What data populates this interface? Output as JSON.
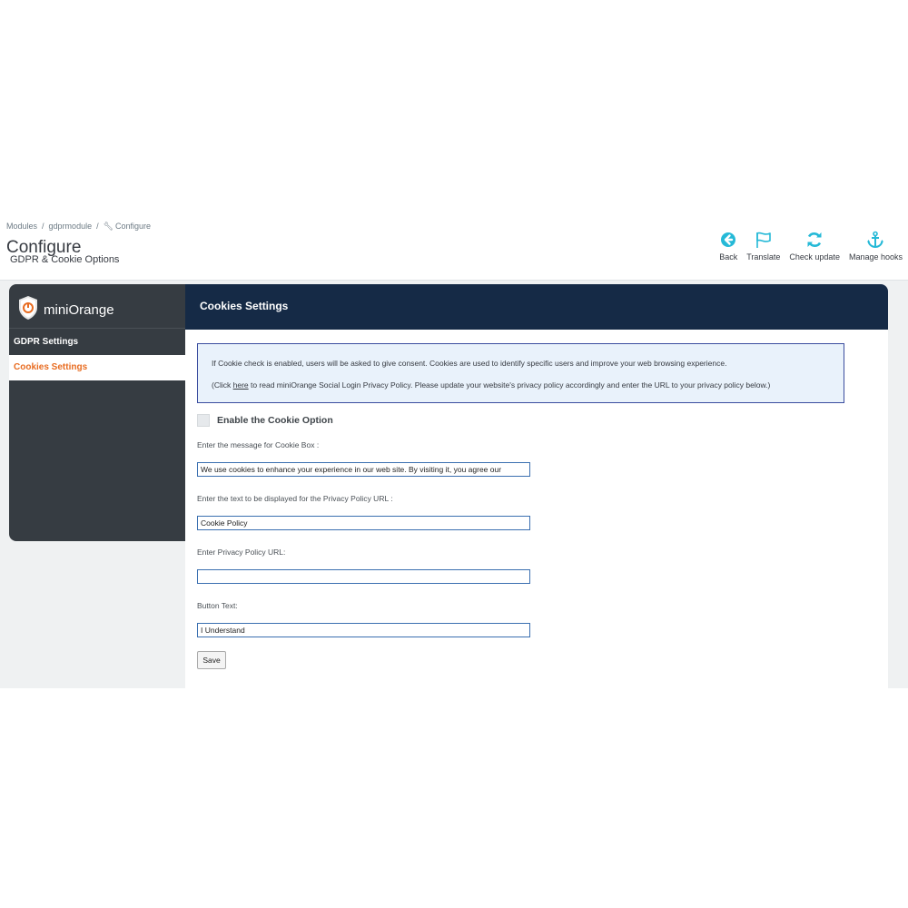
{
  "breadcrumb": {
    "items": [
      "Modules",
      "gdprmodule",
      "Configure"
    ]
  },
  "page": {
    "title": "Configure",
    "subtitle": "GDPR & Cookie Options"
  },
  "toolbar": {
    "back": "Back",
    "translate": "Translate",
    "check_update": "Check update",
    "manage_hooks": "Manage hooks"
  },
  "sidebar": {
    "brand": "miniOrange",
    "items": [
      {
        "label": "GDPR Settings",
        "active": false
      },
      {
        "label": "Cookies Settings",
        "active": true
      }
    ]
  },
  "main": {
    "title": "Cookies Settings",
    "info": {
      "line1": "If Cookie check is enabled, users will be asked to give consent. Cookies are used to identify specific users and improve your web browsing experience.",
      "line2_prefix": "(Click ",
      "link_text": "here",
      "line2_suffix": " to read miniOrange Social Login Privacy Policy. Please update your website's privacy policy accordingly and enter the URL to your privacy policy below.)"
    },
    "enable_label": "Enable the Cookie Option",
    "enable_checked": false,
    "fields": {
      "message_label": "Enter the message for Cookie Box :",
      "message_value": "We use cookies to enhance your experience in our web site. By visiting it, you agree our",
      "policy_text_label": "Enter the text to be displayed for the Privacy Policy URL :",
      "policy_text_value": "Cookie Policy",
      "policy_url_label": "Enter Privacy Policy URL:",
      "policy_url_value": "",
      "button_text_label": "Button Text:",
      "button_text_value": "I Understand"
    },
    "save_label": "Save"
  },
  "colors": {
    "header_dark": "#152a46",
    "sidebar_dark": "#363c42",
    "accent_orange": "#e86c21",
    "toolbar_icon": "#25b9d7",
    "info_border": "#3a4d9f"
  }
}
